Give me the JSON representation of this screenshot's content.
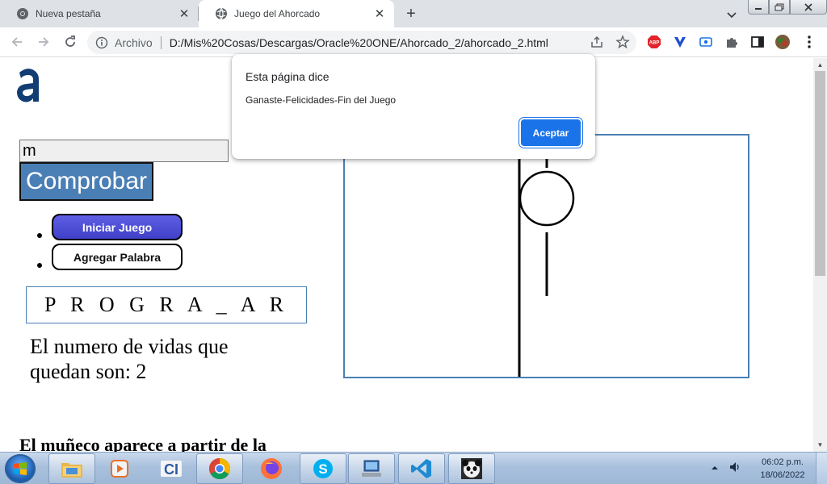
{
  "browser": {
    "tabs": [
      {
        "title": "Nueva pestaña",
        "active": false
      },
      {
        "title": "Juego del Ahorcado",
        "active": true
      }
    ],
    "address": {
      "prefix": "Archivo",
      "url": "D:/Mis%20Cosas/Descargas/Oracle%20ONE/Ahorcado_2/ahorcado_2.html"
    },
    "extensions": [
      "abp-icon",
      "brave-icon",
      "screen-icon",
      "puzzle-icon"
    ]
  },
  "page": {
    "input_value": "m",
    "check_button": "Comprobar",
    "menu": [
      "Iniciar Juego",
      "Agregar Palabra"
    ],
    "word_display": "P R O G R A _ A R",
    "lives_text": "El numero de vidas que quedan son: 2",
    "bottom_heading": "El muñeco aparece a partir de la"
  },
  "dialog": {
    "title": "Esta página dice",
    "message": "Ganaste-Felicidades-Fin del Juego",
    "button": "Aceptar"
  },
  "taskbar": {
    "time": "06:02 p.m.",
    "date": "18/06/2022"
  },
  "colors": {
    "accent": "#1a73e8",
    "check_button": "#4a7fb5",
    "start_button": "#4545d2"
  }
}
